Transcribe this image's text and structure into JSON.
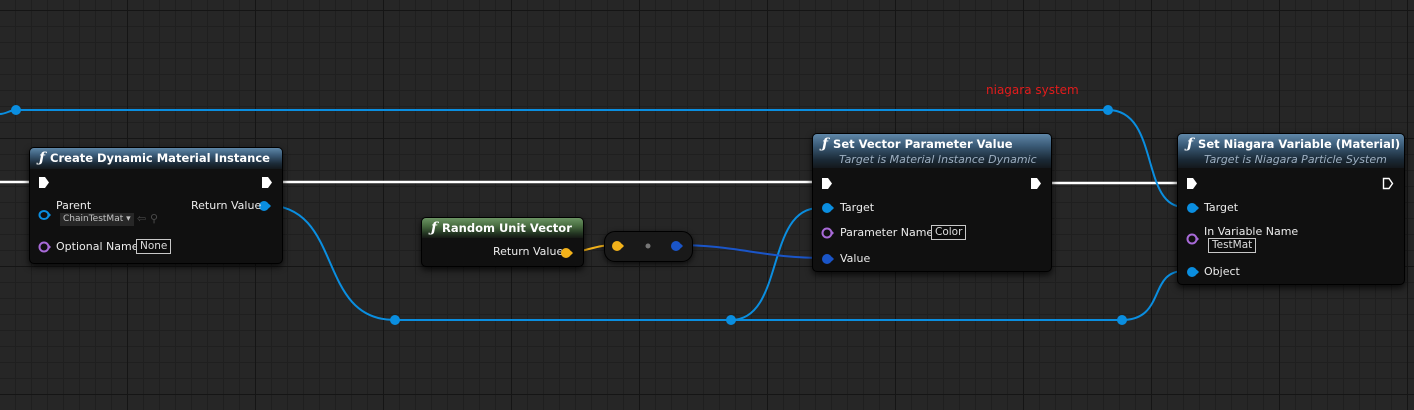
{
  "annotation": {
    "text": "niagara system",
    "color": "#e21c1c"
  },
  "colors": {
    "background": "#262626",
    "object_wire": "#0a8ee0",
    "exec_wire": "#ffffff",
    "vector_wire": "#f3b21a",
    "string_pin": "#a86ad8",
    "linear_color_pin": "#1a55c8"
  },
  "nodes": {
    "create_dmi": {
      "title": "Create Dynamic Material Instance",
      "icon": "function-icon",
      "parent_label": "Parent",
      "parent_asset": "ChainTestMat",
      "optional_name_label": "Optional Name",
      "optional_name_value": "None",
      "return_value_label": "Return Value"
    },
    "random_unit_vector": {
      "title": "Random Unit Vector",
      "icon": "function-icon",
      "return_value_label": "Return Value"
    },
    "set_vector_param": {
      "title": "Set Vector Parameter Value",
      "subtitle": "Target is Material Instance Dynamic",
      "icon": "function-icon",
      "target_label": "Target",
      "parameter_name_label": "Parameter Name",
      "parameter_name_value": "Color",
      "value_label": "Value"
    },
    "set_niagara_var": {
      "title": "Set Niagara Variable (Material)",
      "subtitle": "Target is Niagara Particle System",
      "icon": "function-icon",
      "target_label": "Target",
      "in_variable_name_label": "In Variable Name",
      "in_variable_name_value": "TestMat",
      "object_label": "Object"
    }
  }
}
